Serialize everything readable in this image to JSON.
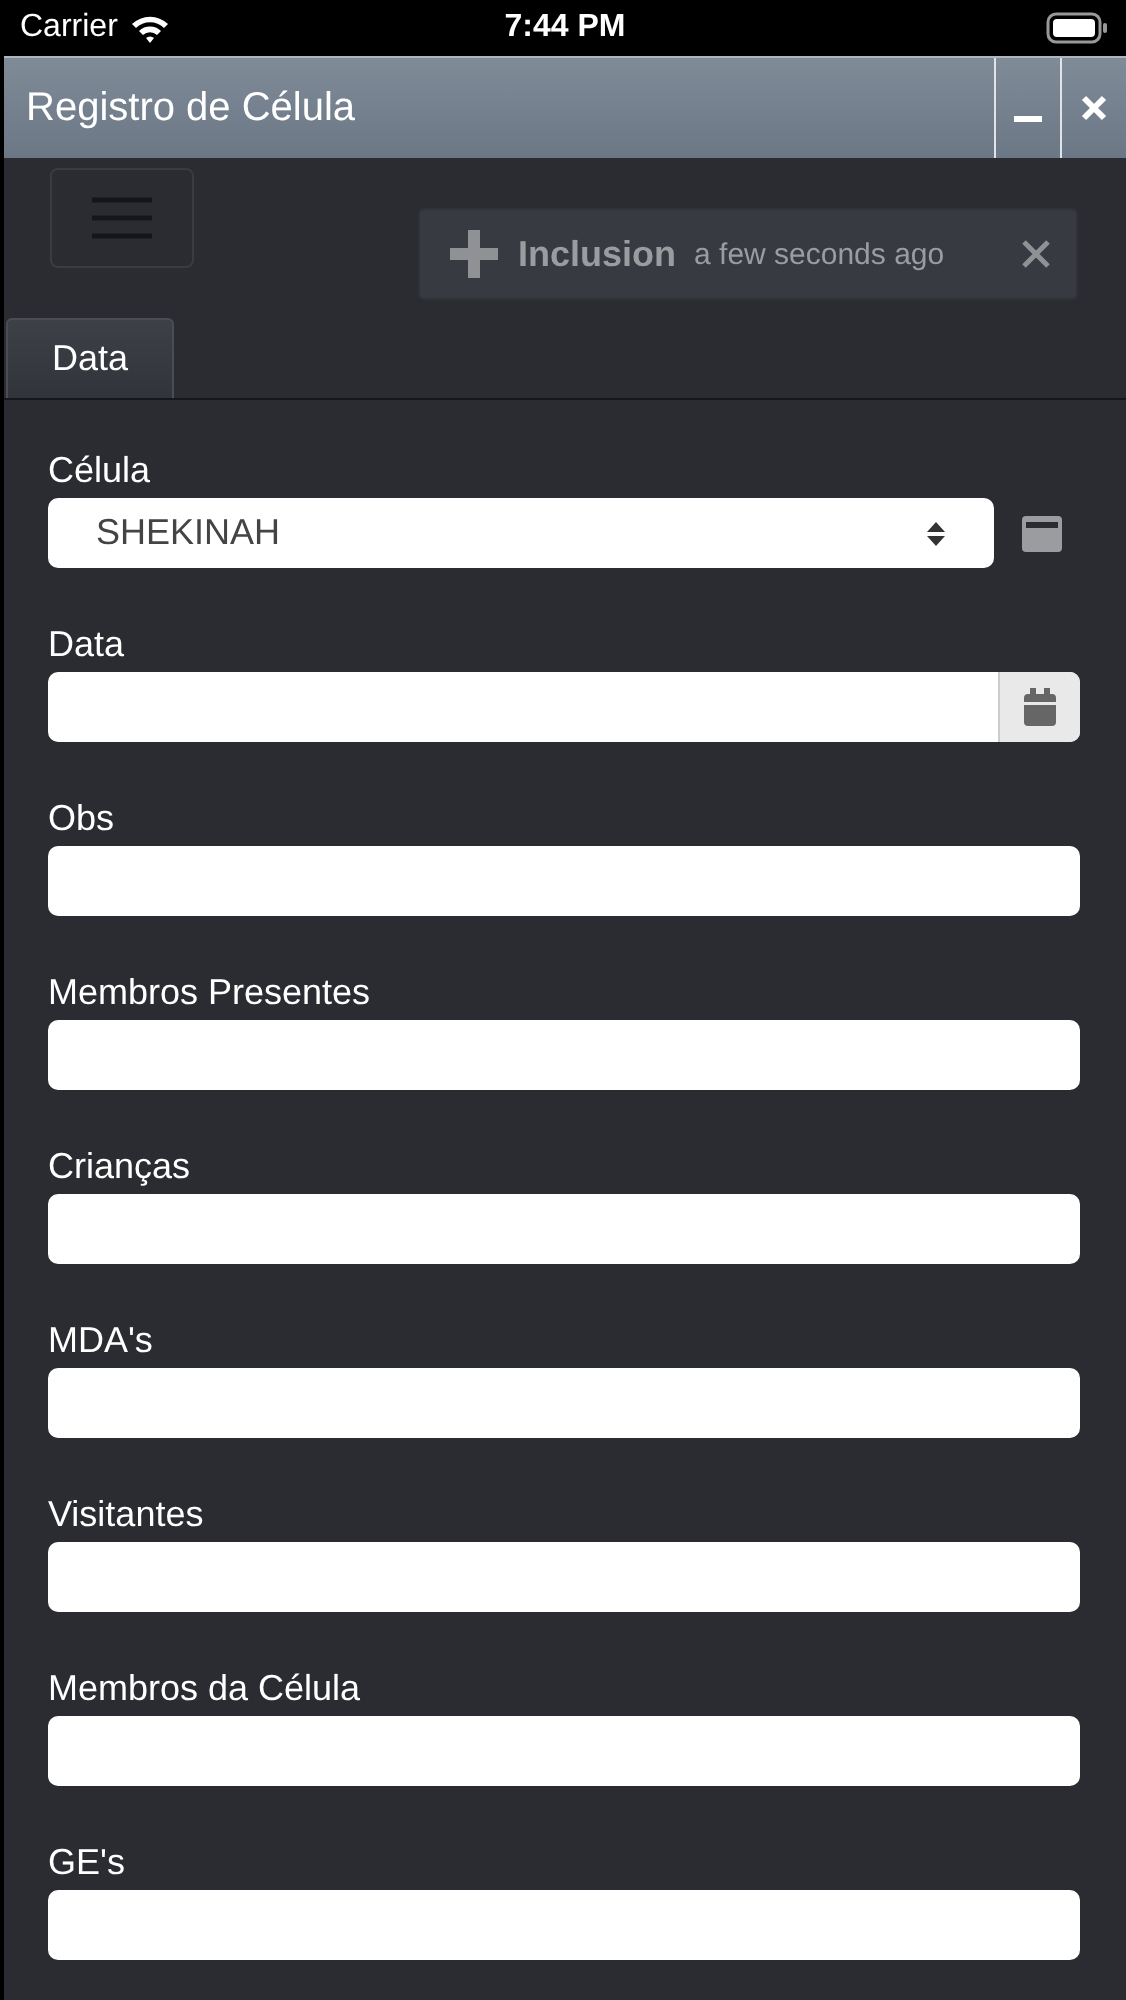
{
  "status_bar": {
    "carrier": "Carrier",
    "time": "7:44 PM"
  },
  "window": {
    "title": "Registro de Célula"
  },
  "notification": {
    "title": "Inclusion",
    "time": "a few seconds ago"
  },
  "tabs": [
    {
      "label": "Data",
      "selected": true
    }
  ],
  "fields": [
    {
      "kind": "select",
      "label": "Célula",
      "value": "SHEKINAH"
    },
    {
      "kind": "date",
      "label": "Data"
    },
    {
      "kind": "text",
      "label": "Obs"
    },
    {
      "kind": "text",
      "label": "Membros Presentes"
    },
    {
      "kind": "text",
      "label": "Crianças"
    },
    {
      "kind": "text",
      "label": "MDA's"
    },
    {
      "kind": "text",
      "label": "Visitantes"
    },
    {
      "kind": "text",
      "label": "Membros da Célula"
    },
    {
      "kind": "text",
      "label": "GE's"
    }
  ]
}
